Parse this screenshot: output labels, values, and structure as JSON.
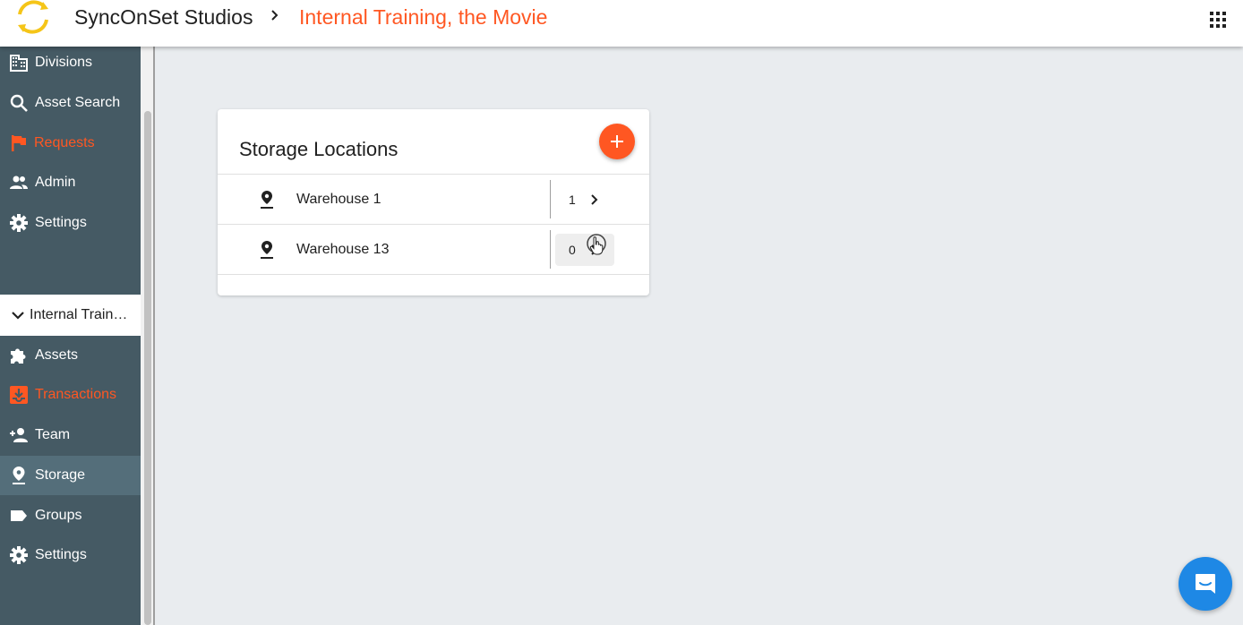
{
  "header": {
    "brand": "SyncOnSet Studios",
    "project": "Internal Training, the Movie",
    "accent_color": "#ff5722"
  },
  "sidebar": {
    "global_items": [
      {
        "label": "Divisions",
        "icon": "building-icon"
      },
      {
        "label": "Asset Search",
        "icon": "search-icon"
      },
      {
        "label": "Requests",
        "icon": "flag-icon"
      },
      {
        "label": "Admin",
        "icon": "people-icon"
      },
      {
        "label": "Settings",
        "icon": "gear-icon"
      }
    ],
    "project_header": "Internal Training, the Movie",
    "project_items": [
      {
        "label": "Assets",
        "icon": "puzzle-icon"
      },
      {
        "label": "Transactions",
        "icon": "inbox-download-icon"
      },
      {
        "label": "Team",
        "icon": "person-add-icon"
      },
      {
        "label": "Storage",
        "icon": "pin-icon"
      },
      {
        "label": "Groups",
        "icon": "label-tag-icon"
      },
      {
        "label": "Settings",
        "icon": "gear-icon"
      }
    ]
  },
  "card": {
    "title": "Storage Locations",
    "locations": [
      {
        "name": "Warehouse 1",
        "count": "1"
      },
      {
        "name": "Warehouse 13",
        "count": "0"
      }
    ]
  }
}
